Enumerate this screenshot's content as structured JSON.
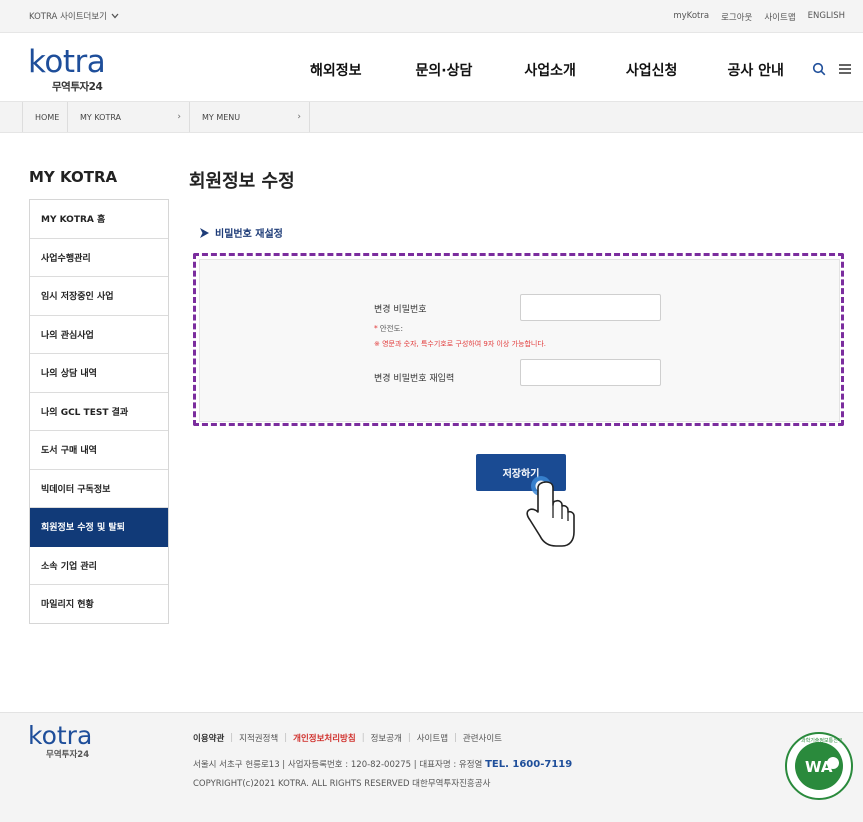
{
  "topbar": {
    "site_select": "KOTRA 사이트더보기",
    "links": [
      "myKotra",
      "로그아웃",
      "사이트맵",
      "ENGLISH"
    ]
  },
  "header": {
    "logo_text": "kotra",
    "logo_sub": "무역투자24",
    "nav": [
      "해외정보",
      "문의·상담",
      "사업소개",
      "사업신청",
      "공사 안내"
    ]
  },
  "breadcrumb": [
    "HOME",
    "MY KOTRA",
    "MY MENU"
  ],
  "sidebar": {
    "title": "MY KOTRA",
    "items": [
      {
        "label": "MY KOTRA 홈"
      },
      {
        "label": "사업수행관리"
      },
      {
        "label": "임시 저장중인 사업"
      },
      {
        "label": "나의 관심사업"
      },
      {
        "label": "나의 상담 내역"
      },
      {
        "label": "나의 GCL TEST 결과"
      },
      {
        "label": "도서 구매 내역"
      },
      {
        "label": "빅데이터 구독정보"
      },
      {
        "label": "회원정보 수정 및 탈퇴"
      },
      {
        "label": "소속 기업 관리"
      },
      {
        "label": "마일리지 현황"
      }
    ],
    "active_index": 8
  },
  "main": {
    "page_title": "회원정보 수정",
    "section_title": "비밀번호 재설정",
    "form": {
      "new_password_label": "변경 비밀번호",
      "new_password_value": "",
      "strength_label": "안전도:",
      "hint": "※ 영문과 숫자, 특수기호로 구성하여 9자 이상 가능합니다.",
      "confirm_password_label": "변경 비밀번호 재입력",
      "confirm_password_value": ""
    },
    "save_label": "저장하기"
  },
  "footer": {
    "logo_text": "kotra",
    "logo_sub": "무역투자24",
    "links": [
      "이용약관",
      "지적권정책",
      "개인정보처리방침",
      "정보공개",
      "사이트맵",
      "관련사이트"
    ],
    "address": "서울시 서초구 헌릉로13 | 사업자등록번호 : 120-82-00275 | 대표자명 : 유정열",
    "tel": "TEL. 1600-7119",
    "copyright": "COPYRIGHT(c)2021 KOTRA. ALL RIGHTS RESERVED 대한무역투자진흥공사",
    "badge_text": "WA",
    "badge_caption": "과학기술정보통신부"
  },
  "colors": {
    "brand_blue": "#1e4e9a",
    "nav_active": "#113a78",
    "button": "#1a4b93",
    "highlight_dashed": "#7b2d9e",
    "warning_red": "#e23b3b",
    "footer_red": "#d0302c"
  },
  "icons": [
    "chevron-down-icon",
    "search-icon",
    "menu-icon",
    "triangle-right-icon",
    "hand-pointer-icon",
    "wa-badge-icon"
  ]
}
